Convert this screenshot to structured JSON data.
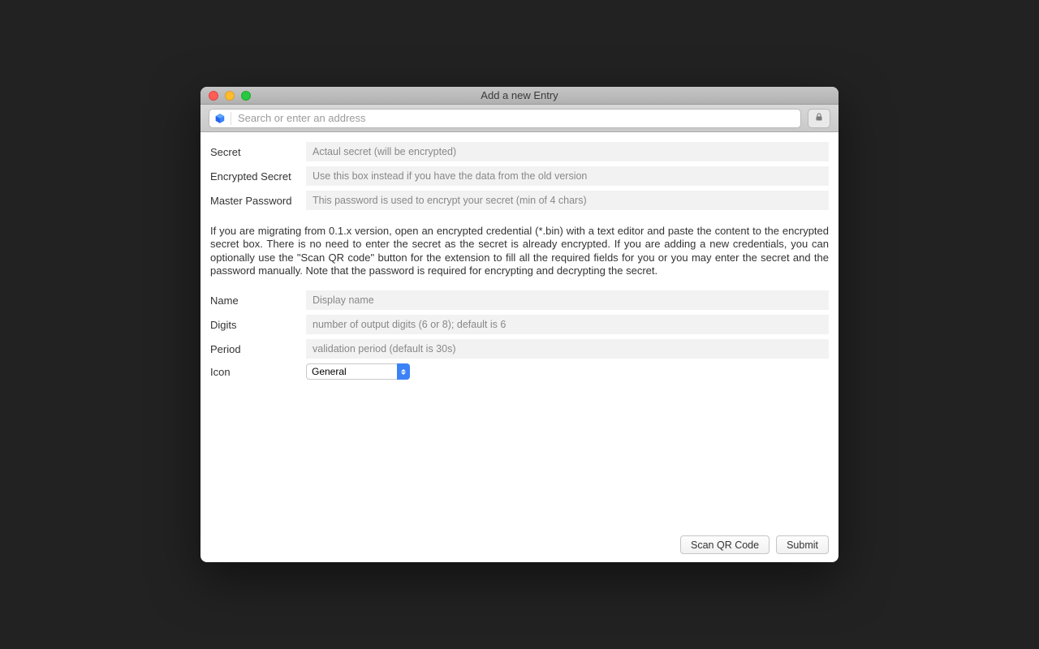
{
  "window": {
    "title": "Add a new Entry"
  },
  "toolbar": {
    "search_placeholder": "Search or enter an address"
  },
  "form": {
    "secret_label": "Secret",
    "secret_placeholder": "Actaul secret (will be encrypted)",
    "encrypted_label": "Encrypted Secret",
    "encrypted_placeholder": "Use this box instead if you have the data from the old version",
    "master_label": "Master Password",
    "master_placeholder": "This password is used to encrypt your secret (min of 4 chars)",
    "name_label": "Name",
    "name_placeholder": "Display name",
    "digits_label": "Digits",
    "digits_placeholder": "number of output digits (6 or 8); default is 6",
    "period_label": "Period",
    "period_placeholder": "validation period (default is 30s)",
    "icon_label": "Icon",
    "icon_selected": "General"
  },
  "info_text": "If you are migrating from 0.1.x version, open an encrypted credential (*.bin) with a text editor and paste the content to the encrypted secret box. There is no need to enter the secret as the secret is already encrypted. If you are adding a new credentials, you can optionally use the \"Scan QR code\" button for the extension to fill all the required fields for you or you may enter the secret and the password manually. Note that the password is required for encrypting and decrypting the secret.",
  "footer": {
    "scan_label": "Scan QR Code",
    "submit_label": "Submit"
  }
}
